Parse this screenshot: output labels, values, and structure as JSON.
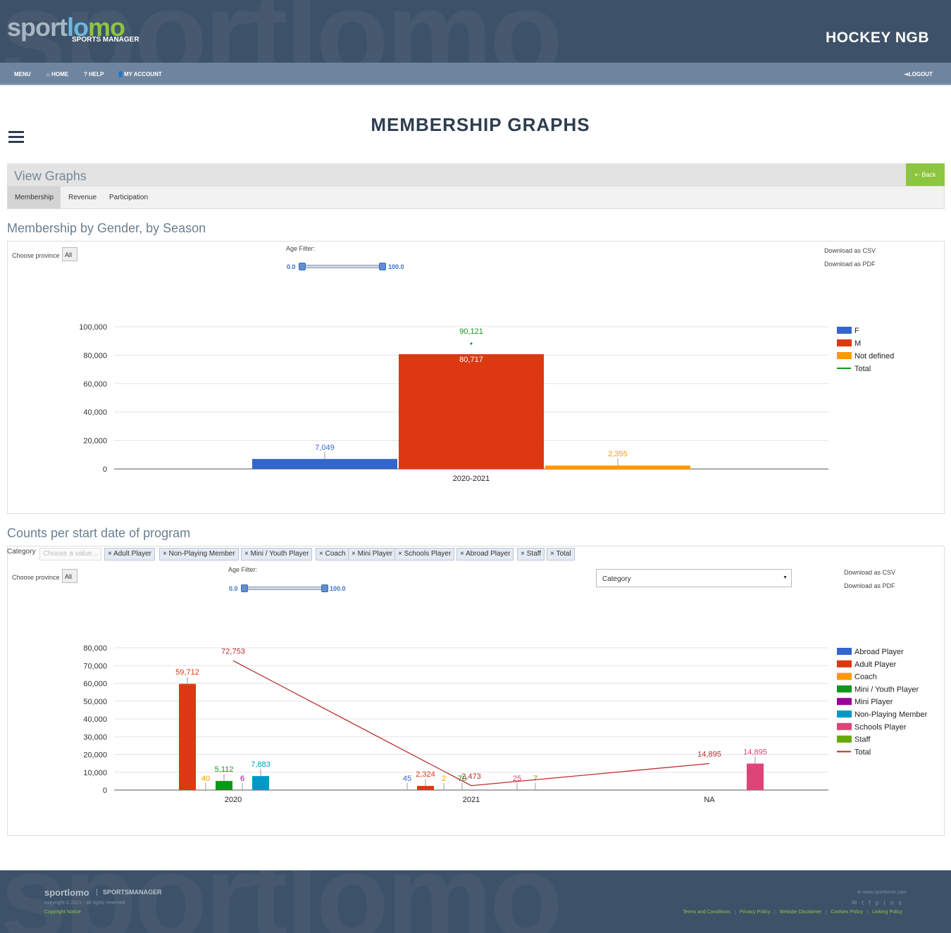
{
  "header": {
    "logo": "sportlomo",
    "logo_sub": "SPORTS MANAGER",
    "org": "HOCKEY NGB"
  },
  "nav": {
    "menu": "MENU",
    "home": "HOME",
    "help": "HELP",
    "account": "MY ACCOUNT",
    "logout": "LOGOUT"
  },
  "page": {
    "title": "MEMBERSHIP GRAPHS",
    "panel_title": "View Graphs",
    "back": "Back",
    "tabs": [
      "Membership",
      "Revenue",
      "Participation"
    ]
  },
  "section1": {
    "title": "Membership by Gender, by Season",
    "province_label": "Choose province",
    "province": "All",
    "age_filter": "Age Filter:",
    "age_min": "0.0",
    "age_max": "100.0",
    "csv": "Download as CSV",
    "pdf": "Download as PDF"
  },
  "section2": {
    "title": "Counts per start date of program",
    "category_label": "Category",
    "category_placeholder": "Choose a value...",
    "chips": [
      "Adult Player",
      "Non-Playing Member",
      "Mini / Youth Player",
      "Coach",
      "Mini Player",
      "Schools Player",
      "Abroad Player",
      "Staff",
      "Total"
    ],
    "province_label": "Choose province",
    "province": "All",
    "age_filter": "Age Filter:",
    "age_min": "0.0",
    "age_max": "100.0",
    "dropdown": "Category",
    "csv": "Download as CSV",
    "pdf": "Download as PDF"
  },
  "chart_data": [
    {
      "type": "bar",
      "categories": [
        "2020-2021"
      ],
      "ylim": [
        0,
        100000
      ],
      "yticks": [
        "0",
        "20,000",
        "40,000",
        "60,000",
        "80,000",
        "100,000"
      ],
      "legend": "right",
      "grid": true,
      "series": [
        {
          "name": "F",
          "color": "#3366cc",
          "values": [
            7049
          ],
          "labels": [
            "7,049"
          ]
        },
        {
          "name": "M",
          "color": "#dc3912",
          "values": [
            80717
          ],
          "labels": [
            "80,717"
          ]
        },
        {
          "name": "Not defined",
          "color": "#ff9900",
          "values": [
            2355
          ],
          "labels": [
            "2,355"
          ]
        },
        {
          "name": "Total",
          "color": "#109618",
          "kind": "line",
          "values": [
            90121
          ],
          "labels": [
            "90,121"
          ]
        }
      ]
    },
    {
      "type": "bar",
      "categories": [
        "2020",
        "2021",
        "NA"
      ],
      "ylim": [
        0,
        80000
      ],
      "yticks": [
        "0",
        "10,000",
        "20,000",
        "30,000",
        "40,000",
        "50,000",
        "60,000",
        "70,000",
        "80,000"
      ],
      "legend": "right",
      "grid": true,
      "series": [
        {
          "name": "Abroad Player",
          "color": "#3366cc",
          "values": [
            null,
            45,
            null
          ],
          "labels": [
            "",
            "45",
            ""
          ]
        },
        {
          "name": "Adult Player",
          "color": "#dc3912",
          "values": [
            59712,
            2324,
            null
          ],
          "labels": [
            "59,712",
            "2,324",
            ""
          ]
        },
        {
          "name": "Coach",
          "color": "#ff9900",
          "values": [
            40,
            2,
            null
          ],
          "labels": [
            "40",
            "2",
            ""
          ]
        },
        {
          "name": "Mini / Youth Player",
          "color": "#109618",
          "values": [
            5112,
            70,
            null
          ],
          "labels": [
            "5,112",
            "70",
            ""
          ]
        },
        {
          "name": "Mini Player",
          "color": "#990099",
          "values": [
            6,
            null,
            null
          ],
          "labels": [
            "6",
            "",
            ""
          ]
        },
        {
          "name": "Non-Playing Member",
          "color": "#0099c6",
          "values": [
            7883,
            null,
            null
          ],
          "labels": [
            "7,883",
            "",
            ""
          ]
        },
        {
          "name": "Schools Player",
          "color": "#dd4477",
          "values": [
            null,
            25,
            14895
          ],
          "labels": [
            "",
            "25",
            "14,895"
          ]
        },
        {
          "name": "Staff",
          "color": "#66aa00",
          "values": [
            null,
            7,
            null
          ],
          "labels": [
            "",
            "7",
            ""
          ]
        },
        {
          "name": "Total",
          "color": "#b82e2e",
          "kind": "line",
          "values": [
            72753,
            2473,
            14895
          ],
          "labels": [
            "72,753",
            "2,473",
            "14,895"
          ]
        }
      ]
    }
  ],
  "footer": {
    "logo": "sportlomo",
    "sub": "SPORTSMANAGER",
    "copyright": "copyright © 2021 - all rights reserved",
    "notice": "Copyright Notice",
    "site": "www.sportlomo.com",
    "links": [
      "Terms and Conditions",
      "Privacy Policy",
      "Website Disclaimer",
      "Cookies Policy",
      "Linking Policy"
    ]
  }
}
